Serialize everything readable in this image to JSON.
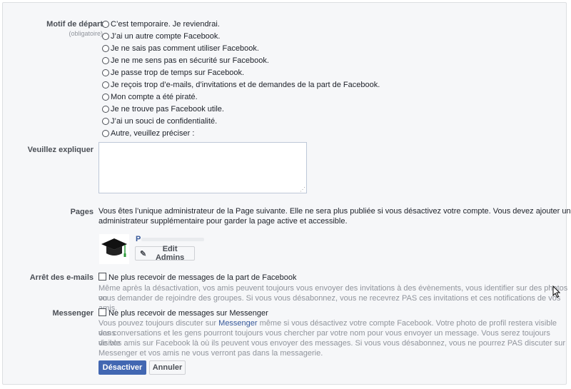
{
  "reason": {
    "label": "Motif de départ",
    "required": "(obligatoire)",
    "options": [
      "C’est temporaire. Je reviendrai.",
      "J’ai un autre compte Facebook.",
      "Je ne sais pas comment utiliser Facebook.",
      "Je ne me sens pas en sécurité sur Facebook.",
      "Je passe trop de temps sur Facebook.",
      "Je reçois trop d’e-mails, d’invitations et de demandes de la part de Facebook.",
      "Mon compte a été piraté.",
      "Je ne trouve pas Facebook utile.",
      "J’ai un souci de confidentialité.",
      "Autre, veuillez préciser :"
    ]
  },
  "explain": {
    "label": "Veuillez expliquer",
    "value": ""
  },
  "pages": {
    "label": "Pages",
    "text_line1": "Vous êtes l’unique administrateur de la Page suivante. Elle ne sera plus publiée si vous désactivez votre compte. Vous devez ajouter un",
    "text_line2": "administrateur supplémentaire pour garder la page active et accessible.",
    "page_initial": "P",
    "edit_admins": "Edit Admins",
    "icon": "graduation-cap"
  },
  "emails": {
    "label": "Arrêt des e-mails",
    "checkbox_label": "Ne plus recevoir de messages de la part de Facebook",
    "desc_line1": "Même après la désactivation, vos amis peuvent toujours vous envoyer des invitations à des évènements, vous identifier sur des photos ou",
    "desc_line2": "vous demander de rejoindre des groupes. Si vous vous désabonnez, vous ne recevrez PAS ces invitations et ces notifications de vos amis."
  },
  "messenger": {
    "label": "Messenger",
    "checkbox_label": "Ne plus recevoir de messages sur Messenger",
    "desc_pre": "Vous pouvez toujours discuter sur ",
    "desc_link": "Messenger",
    "desc_post": " même si vous désactivez votre compte Facebook. Votre photo de profil restera visible dans",
    "desc_line2": "vos conversations et les gens pourront toujours vous chercher par votre nom pour vous envoyer un message. Vous serez toujours visible",
    "desc_line3": "de vos amis sur Facebook là où ils peuvent vous envoyer des messages. Si vous vous désabonnez, vous ne pourrez PAS discuter sur",
    "desc_line4": "Messenger et vos amis ne vous verront pas dans la messagerie."
  },
  "actions": {
    "deactivate": "Désactiver",
    "cancel": "Annuler"
  },
  "colors": {
    "primary": "#4267b2",
    "link": "#365899",
    "muted": "#90949c"
  }
}
